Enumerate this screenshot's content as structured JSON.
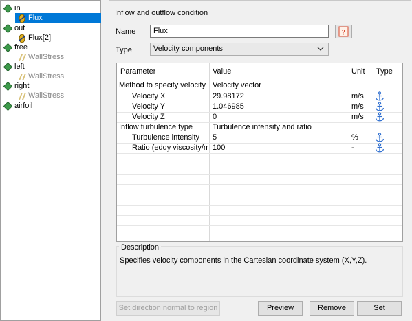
{
  "tree": {
    "items": [
      {
        "label": "in",
        "children": [
          {
            "label": "Flux",
            "selected": true
          }
        ]
      },
      {
        "label": "out",
        "children": [
          {
            "label": "Flux[2]"
          }
        ]
      },
      {
        "label": "free",
        "children": [
          {
            "label": "WallStress"
          }
        ]
      },
      {
        "label": "left",
        "children": [
          {
            "label": "WallStress"
          }
        ]
      },
      {
        "label": "right",
        "children": [
          {
            "label": "WallStress"
          }
        ]
      },
      {
        "label": "airfoil",
        "children": []
      }
    ]
  },
  "panel": {
    "title": "Inflow and outflow condition",
    "name_label": "Name",
    "name_value": "Flux",
    "type_label": "Type",
    "type_value": "Velocity components",
    "table": {
      "headers": {
        "parameter": "Parameter",
        "value": "Value",
        "unit": "Unit",
        "type": "Type"
      },
      "rows": [
        {
          "parameter": "Method to specify velocity",
          "value": "Velocity vector",
          "unit": "",
          "has_type_icon": false
        },
        {
          "parameter": "Velocity X",
          "value": "29.98172",
          "unit": "m/s",
          "has_type_icon": true
        },
        {
          "parameter": "Velocity Y",
          "value": "1.046985",
          "unit": "m/s",
          "has_type_icon": true
        },
        {
          "parameter": "Velocity Z",
          "value": "0",
          "unit": "m/s",
          "has_type_icon": true
        },
        {
          "parameter": "Inflow turbulence type",
          "value": "Turbulence intensity and ratio",
          "unit": "",
          "has_type_icon": false
        },
        {
          "parameter": "Turbulence intensity",
          "value": "5",
          "unit": "%",
          "has_type_icon": true
        },
        {
          "parameter": "Ratio (eddy viscosity/m...",
          "value": "100",
          "unit": "-",
          "has_type_icon": true
        }
      ]
    },
    "description": {
      "title": "Description",
      "text": "Specifies velocity components in the Cartesian coordinate system (X,Y,Z)."
    },
    "buttons": {
      "direction": "Set direction normal to region",
      "preview": "Preview",
      "remove": "Remove",
      "set": "Set"
    }
  },
  "colors": {
    "selection": "#0078d7",
    "node_icon": "#3c9a4a",
    "anchor_icon": "#2f6fd0",
    "help_icon": "#d9462a"
  }
}
